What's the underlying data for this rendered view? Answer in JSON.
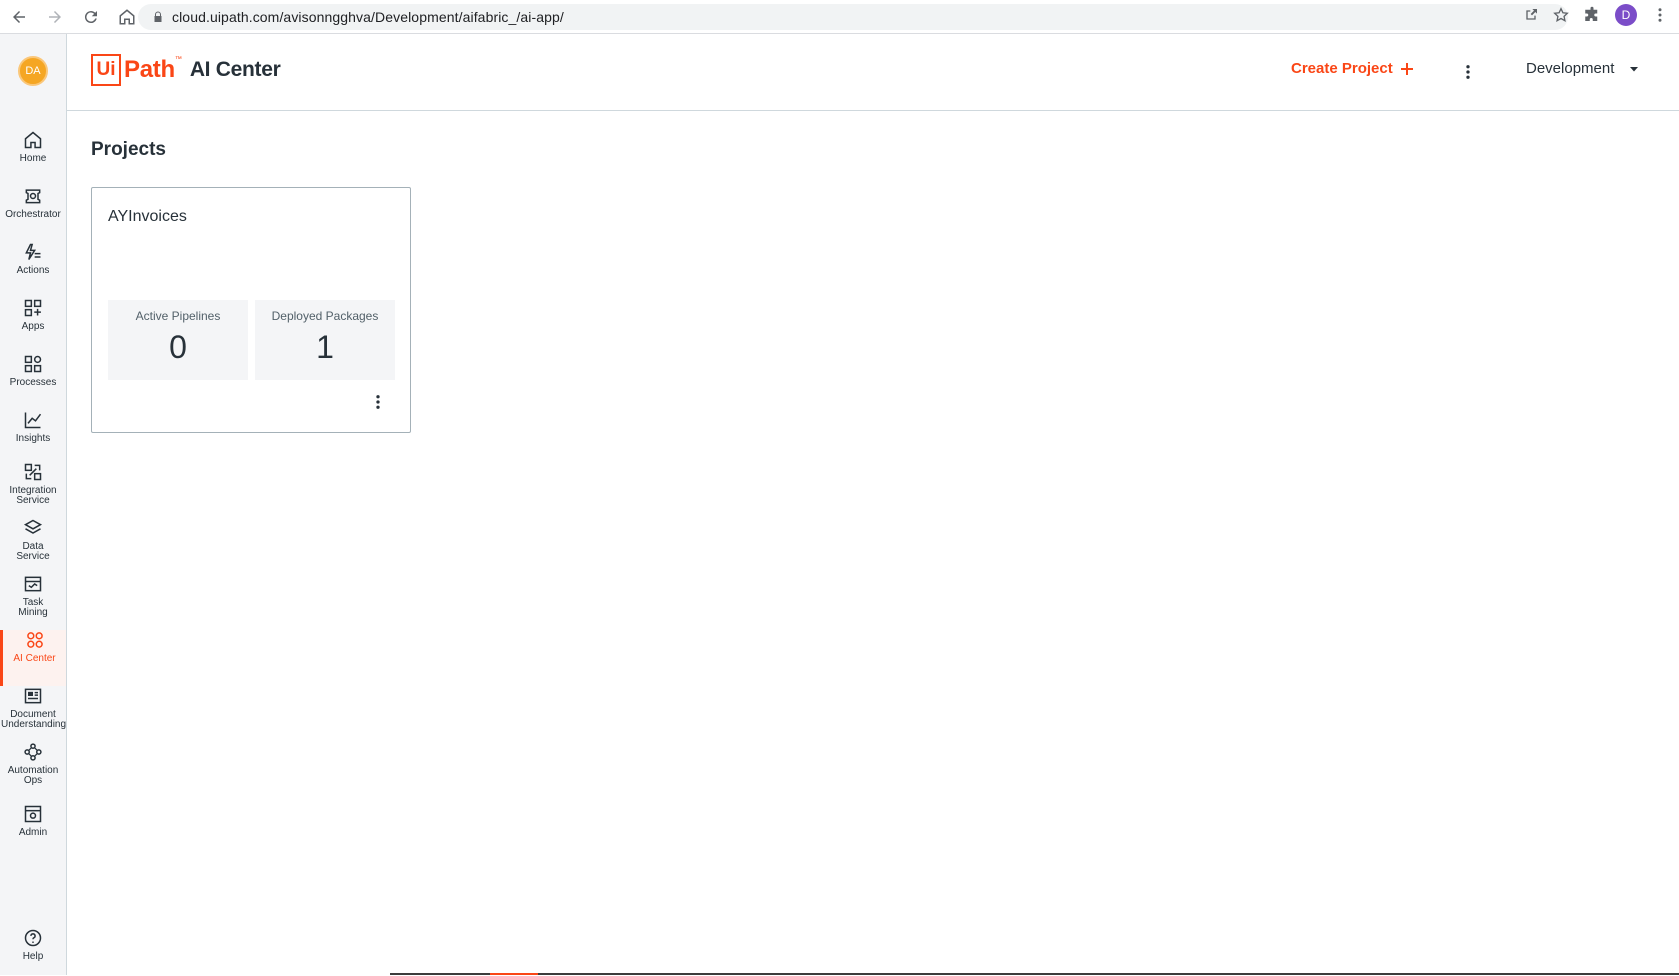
{
  "browser": {
    "url": "cloud.uipath.com/avisonngghva/Development/aifabric_/ai-app/",
    "profile_initial": "D"
  },
  "user": {
    "initials": "DA"
  },
  "sidebar": {
    "items": [
      {
        "id": "home",
        "label": "Home",
        "icon": "home-icon"
      },
      {
        "id": "orchestrator",
        "label": "Orchestrator",
        "icon": "orchestrator-icon"
      },
      {
        "id": "actions",
        "label": "Actions",
        "icon": "actions-icon"
      },
      {
        "id": "apps",
        "label": "Apps",
        "icon": "apps-icon"
      },
      {
        "id": "processes",
        "label": "Processes",
        "icon": "processes-icon"
      },
      {
        "id": "insights",
        "label": "Insights",
        "icon": "insights-icon"
      },
      {
        "id": "integration",
        "label": "Integration Service",
        "icon": "integration-icon"
      },
      {
        "id": "data-service",
        "label": "Data Service",
        "icon": "data-service-icon"
      },
      {
        "id": "task-mining",
        "label": "Task Mining",
        "icon": "task-mining-icon"
      },
      {
        "id": "ai-center",
        "label": "AI Center",
        "icon": "ai-center-icon",
        "active": true
      },
      {
        "id": "document-understanding",
        "label": "Document Understanding",
        "icon": "document-icon"
      },
      {
        "id": "automation-ops",
        "label": "Automation Ops",
        "icon": "automation-ops-icon"
      },
      {
        "id": "admin",
        "label": "Admin",
        "icon": "admin-icon"
      }
    ],
    "help_label": "Help"
  },
  "header": {
    "logo_ui": "Ui",
    "logo_path": "Path",
    "logo_tm": "™",
    "product_name": "AI Center",
    "create_project_label": "Create Project",
    "tenant": "Development"
  },
  "main": {
    "title": "Projects",
    "projects": [
      {
        "name": "AYInvoices",
        "stats": [
          {
            "label": "Active Pipelines",
            "value": "0"
          },
          {
            "label": "Deployed Packages",
            "value": "1"
          }
        ]
      }
    ]
  },
  "colors": {
    "brand": "#fa4616",
    "text": "#273139",
    "sidebar_bg": "#f4f5f7",
    "avatar": "#f5a623",
    "profile": "#7b4dc8"
  }
}
